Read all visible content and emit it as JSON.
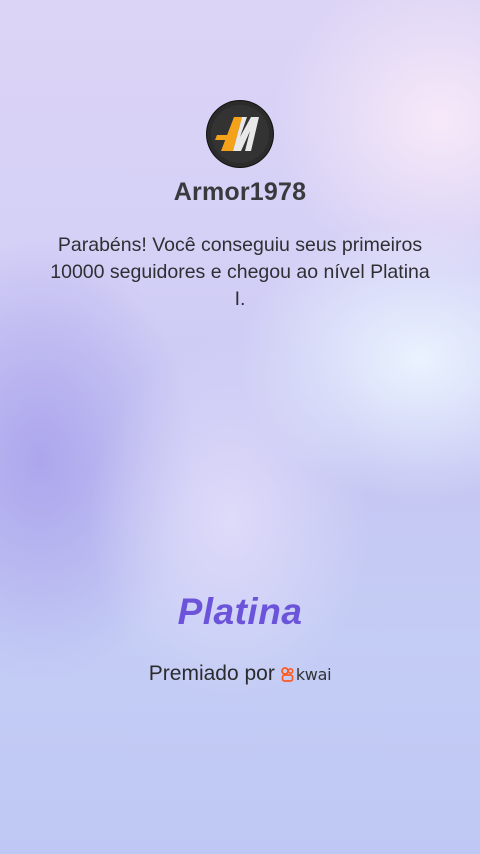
{
  "profile": {
    "username": "Armor1978",
    "avatar_icon": "armor-logo-icon"
  },
  "message": "Parabéns! Você conseguiu seus primeiros 10000 seguidores e chegou ao nível Platina I.",
  "level": {
    "name": "Platina",
    "color": "#6b54d9"
  },
  "awarded": {
    "label": "Premiado por",
    "brand": "kwai",
    "brand_color": "#ff5a1f"
  }
}
